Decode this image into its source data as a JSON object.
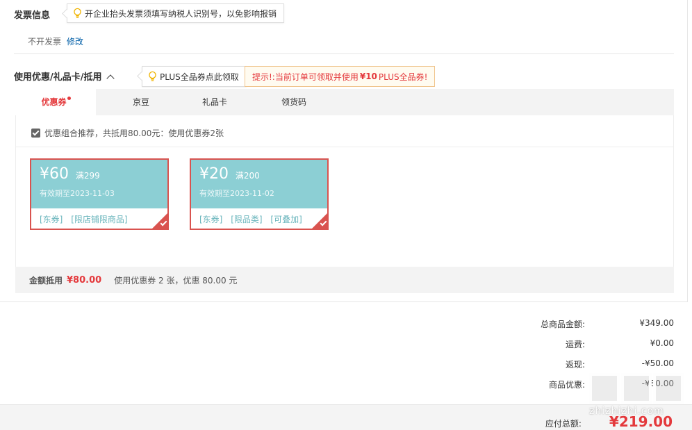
{
  "invoice": {
    "title": "发票信息",
    "tip": "开企业抬头发票须填写纳税人识别号，以免影响报销",
    "status": "不开发票",
    "edit_link": "修改"
  },
  "discount": {
    "title": "使用优惠/礼品卡/抵用",
    "plus_tip": "PLUS全品券点此领取",
    "promo_prefix": "提示!:当前订单可领取并使用",
    "promo_amount": "¥10",
    "promo_suffix": "PLUS全品券!",
    "tabs": [
      {
        "label": "优惠券",
        "active": true
      },
      {
        "label": "京豆",
        "active": false
      },
      {
        "label": "礼品卡",
        "active": false
      },
      {
        "label": "领货码",
        "active": false
      }
    ],
    "combo_text": "优惠组合推荐，共抵用80.00元：使用优惠券2张",
    "coupons": [
      {
        "amount": "¥60",
        "condition": "满299",
        "expiry": "有效期至2023-11-03",
        "tags": [
          "[东券]",
          "[限店铺限商品]"
        ]
      },
      {
        "amount": "¥20",
        "condition": "满200",
        "expiry": "有效期至2023-11-02",
        "tags": [
          "[东券]",
          "[限品类]",
          "[可叠加]"
        ]
      }
    ],
    "summary_label": "金额抵用",
    "summary_amount": "¥80.00",
    "summary_desc": "使用优惠券 2 张，优惠 80.00 元"
  },
  "totals": [
    {
      "label": "总商品金额:",
      "value": "¥349.00"
    },
    {
      "label": "运费:",
      "value": "¥0.00"
    },
    {
      "label": "返现:",
      "value": "-¥50.00"
    },
    {
      "label": "商品优惠:",
      "value": "-¥80.00"
    }
  ],
  "payable": {
    "label": "应付总额:",
    "value": "¥219.00"
  },
  "watermark": "zhizhizhi.com",
  "colors": {
    "accent": "#e4393c",
    "coupon": "#8ccfd4",
    "link": "#005ea7"
  }
}
